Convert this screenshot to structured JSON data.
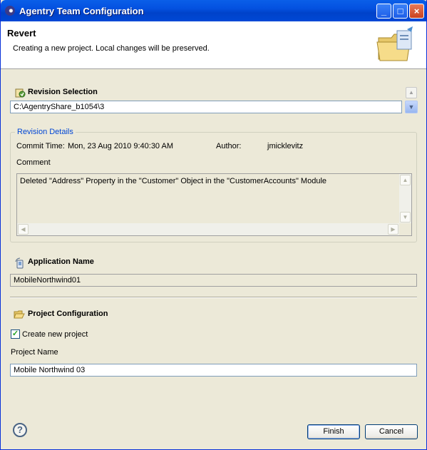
{
  "window": {
    "title": "Agentry Team Configuration"
  },
  "header": {
    "title": "Revert",
    "subtitle": "Creating a new project.  Local changes will be preserved."
  },
  "revision_selection": {
    "label": "Revision Selection",
    "value": "C:\\AgentryShare_b1054\\3"
  },
  "revision_details": {
    "legend": "Revision Details",
    "commit_time_label": "Commit Time:",
    "commit_time_value": "Mon, 23 Aug 2010 9:40:30 AM",
    "author_label": "Author:",
    "author_value": "jmicklevitz",
    "comment_label": "Comment",
    "comment_text": "Deleted \"Address\" Property in the \"Customer\" Object in the \"CustomerAccounts\" Module"
  },
  "application_name": {
    "label": "Application Name",
    "value": "MobileNorthwind01"
  },
  "project_configuration": {
    "label": "Project Configuration",
    "create_new_label": "Create new project",
    "create_new_checked": true,
    "project_name_label": "Project Name",
    "project_name_value": "Mobile Northwind 03"
  },
  "buttons": {
    "finish": "Finish",
    "cancel": "Cancel"
  },
  "icons": {
    "window": "eclipse-icon",
    "header": "folder-wizard-icon",
    "revision": "revision-icon",
    "application": "application-icon",
    "project": "open-folder-icon",
    "help": "help-icon"
  }
}
